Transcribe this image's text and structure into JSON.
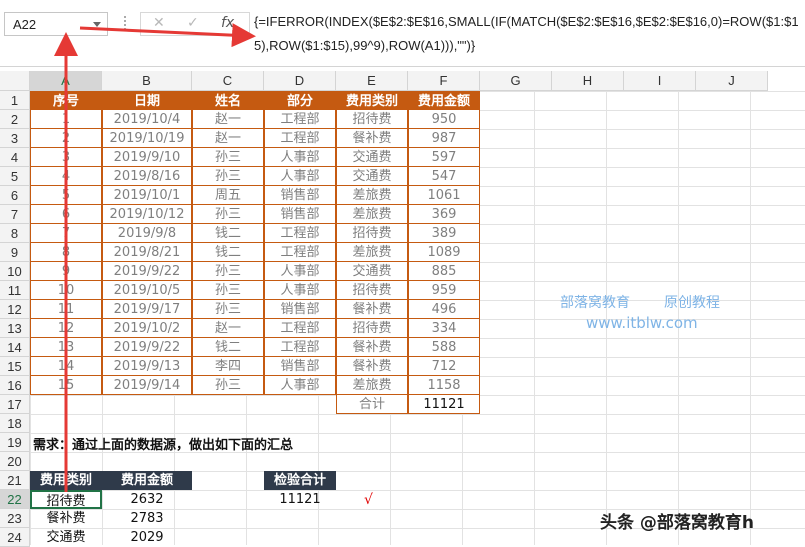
{
  "name_box": "A22",
  "formula_bar": {
    "cancel_icon": "✕",
    "enter_icon": "✓",
    "fx_icon": "fx",
    "formula": "{=IFERROR(INDEX($E$2:$E$16,SMALL(IF(MATCH($E$2:$E$16,$E$2:$E$16,0)=ROW($1:$15),ROW($1:$15),99^9),ROW(A1))),\"\")}"
  },
  "columns": [
    "A",
    "B",
    "C",
    "D",
    "E",
    "F",
    "G",
    "H",
    "I",
    "J"
  ],
  "rows": [
    "1",
    "2",
    "3",
    "4",
    "5",
    "6",
    "7",
    "8",
    "9",
    "10",
    "11",
    "12",
    "13",
    "14",
    "15",
    "16",
    "17",
    "18",
    "19",
    "20",
    "21",
    "22",
    "23",
    "24"
  ],
  "table": {
    "headers": [
      "序号",
      "日期",
      "姓名",
      "部分",
      "费用类别",
      "费用金额"
    ],
    "rows": [
      [
        "1",
        "2019/10/4",
        "赵一",
        "工程部",
        "招待费",
        "950"
      ],
      [
        "2",
        "2019/10/19",
        "赵一",
        "工程部",
        "餐补费",
        "987"
      ],
      [
        "3",
        "2019/9/10",
        "孙三",
        "人事部",
        "交通费",
        "597"
      ],
      [
        "4",
        "2019/8/16",
        "孙三",
        "人事部",
        "交通费",
        "547"
      ],
      [
        "5",
        "2019/10/1",
        "周五",
        "销售部",
        "差旅费",
        "1061"
      ],
      [
        "6",
        "2019/10/12",
        "孙三",
        "销售部",
        "差旅费",
        "369"
      ],
      [
        "7",
        "2019/9/8",
        "钱二",
        "工程部",
        "招待费",
        "389"
      ],
      [
        "8",
        "2019/8/21",
        "钱二",
        "工程部",
        "差旅费",
        "1089"
      ],
      [
        "9",
        "2019/9/22",
        "孙三",
        "人事部",
        "交通费",
        "885"
      ],
      [
        "10",
        "2019/10/5",
        "孙三",
        "人事部",
        "招待费",
        "959"
      ],
      [
        "11",
        "2019/9/17",
        "孙三",
        "销售部",
        "餐补费",
        "496"
      ],
      [
        "12",
        "2019/10/2",
        "赵一",
        "工程部",
        "招待费",
        "334"
      ],
      [
        "13",
        "2019/9/22",
        "钱二",
        "工程部",
        "餐补费",
        "588"
      ],
      [
        "14",
        "2019/9/13",
        "李四",
        "销售部",
        "餐补费",
        "712"
      ],
      [
        "15",
        "2019/9/14",
        "孙三",
        "人事部",
        "差旅费",
        "1158"
      ]
    ],
    "total_label": "合计",
    "total_value": "11121"
  },
  "requirement": "需求：通过上面的数据源，做出如下面的汇总",
  "summary": {
    "headers": [
      "费用类别",
      "费用金额"
    ],
    "rows": [
      [
        "招待费",
        "2632"
      ],
      [
        "餐补费",
        "2783"
      ],
      [
        "交通费",
        "2029"
      ]
    ]
  },
  "check": {
    "header": "检验合计",
    "value": "11121",
    "mark": "√"
  },
  "watermark": {
    "line1a": "部落窝教育",
    "line1b": "原创教程",
    "line2": "www.itblw.com"
  },
  "brand": "头条 @部落窝教育h",
  "colors": {
    "table_header": "#c55a11",
    "summary_header": "#2f3a4a",
    "arrow": "#e53935",
    "selection": "#217346"
  }
}
